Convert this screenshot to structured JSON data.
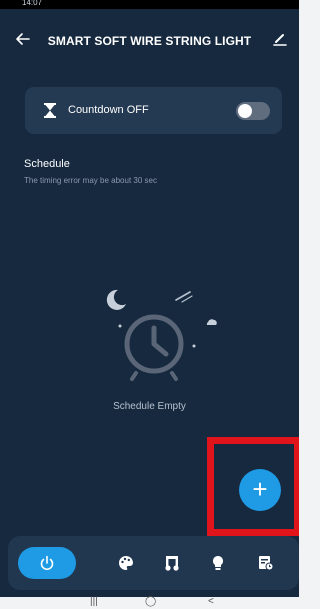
{
  "statusbar": {
    "time": "14:07",
    "sys": ""
  },
  "header": {
    "title": "SMART SOFT WIRE STRING LIGHT"
  },
  "countdown": {
    "label": "Countdown OFF",
    "enabled": false
  },
  "schedule": {
    "title": "Schedule",
    "subtitle": "The timing error may be about 30 sec",
    "empty_text": "Schedule Empty"
  },
  "fab": {
    "label": "+"
  },
  "colors": {
    "background": "#16293f",
    "card": "#243a53",
    "accent": "#1e9be4",
    "highlight": "#e2141b"
  },
  "bottom_tabs": [
    {
      "icon": "power-icon",
      "active": true
    },
    {
      "icon": "palette-icon",
      "active": false
    },
    {
      "icon": "music-icon",
      "active": false
    },
    {
      "icon": "bulb-icon",
      "active": false
    },
    {
      "icon": "schedule-icon",
      "active": false
    }
  ]
}
